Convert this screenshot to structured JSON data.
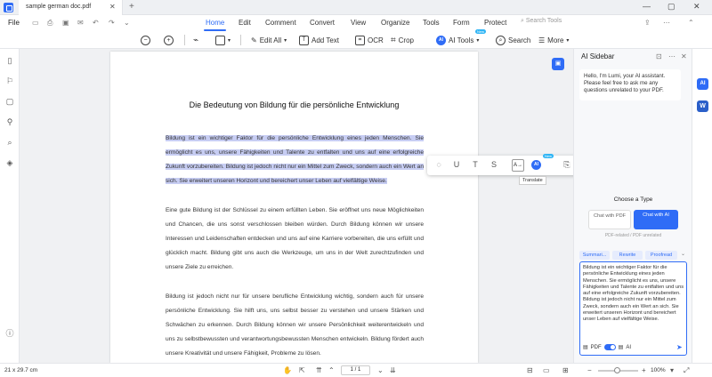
{
  "window": {
    "tab_title": "sample german doc.pdf",
    "tab_close": "✕",
    "new_tab": "+",
    "min": "—",
    "max": "▢",
    "close": "✕"
  },
  "menubar": {
    "file": "File",
    "items": [
      "Home",
      "Edit",
      "Comment",
      "Convert",
      "View",
      "Organize",
      "Tools",
      "Form",
      "Protect"
    ],
    "search_placeholder": "Search Tools"
  },
  "toolbar": {
    "edit_all": "Edit All",
    "add_text": "Add Text",
    "ocr": "OCR",
    "crop": "Crop",
    "ai_tools": "AI Tools",
    "new_badge": "New",
    "search": "Search",
    "more": "More"
  },
  "document": {
    "heading": "Die Bedeutung von Bildung für die persönliche Entwicklung",
    "para1": "Bildung ist ein wichtiger Faktor für die persönliche Entwicklung eines jeden Menschen. Sie ermöglicht es uns, unsere Fähigkeiten und Talente zu entfalten und uns auf eine erfolgreiche Zukunft vorzubereiten. Bildung ist jedoch nicht nur ein Mittel zum Zweck, sondern auch ein Wert an sich. Sie erweitert unseren Horizont und bereichert unser Leben auf vielfältige Weise.",
    "para2": "Eine gute Bildung ist der Schlüssel zu einem erfüllten Leben. Sie eröffnet uns neue Möglichkeiten und Chancen, die uns sonst verschlossen bleiben würden. Durch Bildung können wir unsere Interessen und Leidenschaften entdecken und uns auf eine Karriere vorbereiten, die uns erfüllt und glücklich macht. Bildung gibt uns auch die Werkzeuge, um uns in der Welt zurechtzufinden und unsere Ziele zu erreichen.",
    "para3": "Bildung ist jedoch nicht nur für unsere berufliche Entwicklung wichtig, sondern auch für unsere persönliche Entwicklung. Sie hilft uns, uns selbst besser zu verstehen und unsere Stärken und Schwächen zu erkennen. Durch Bildung können wir unsere Persönlichkeit weiterentwickeln und uns zu selbstbewussten und verantwortungsbewussten Menschen entwickeln. Bildung fördert auch unsere Kreativität und unsere Fähigkeit, Probleme zu lösen."
  },
  "float_toolbar": {
    "tooltip": "Translate",
    "ai": "AI",
    "new_badge": "New"
  },
  "sidebar": {
    "title": "AI Sidebar",
    "greeting": "Hello, I'm Lumi, your AI assistant. Please feel free to ask me any questions unrelated to your PDF.",
    "choose_type": "Choose a Type",
    "chat_pdf": "Chat with PDF",
    "chat_ai": "Chat with AI",
    "note": "PDF-related / PDF unrelated",
    "chips": [
      "Summari...",
      "Rewrite",
      "Proofread"
    ],
    "input_text": "Bildung ist ein wichtiger Faktor für die persönliche Entwicklung eines jeden Menschen. Sie ermöglicht es uns, unsere Fähigkeiten und Talente zu entfalten und uns auf eine erfolgreiche Zukunft vorzubereiten. Bildung ist jedoch nicht nur ein Mittel zum Zweck, sondern auch ein Wert an sich. Sie erweitert unseren Horizont und bereichert unser Leben auf vielfältige Weise.",
    "pdf_label": "PDF",
    "ai_label": "AI"
  },
  "rightrail": {
    "ai": "AI",
    "word": "W"
  },
  "status": {
    "page_size": "21 x 29.7 cm",
    "page_num": "1 / 1",
    "zoom": "100%"
  }
}
